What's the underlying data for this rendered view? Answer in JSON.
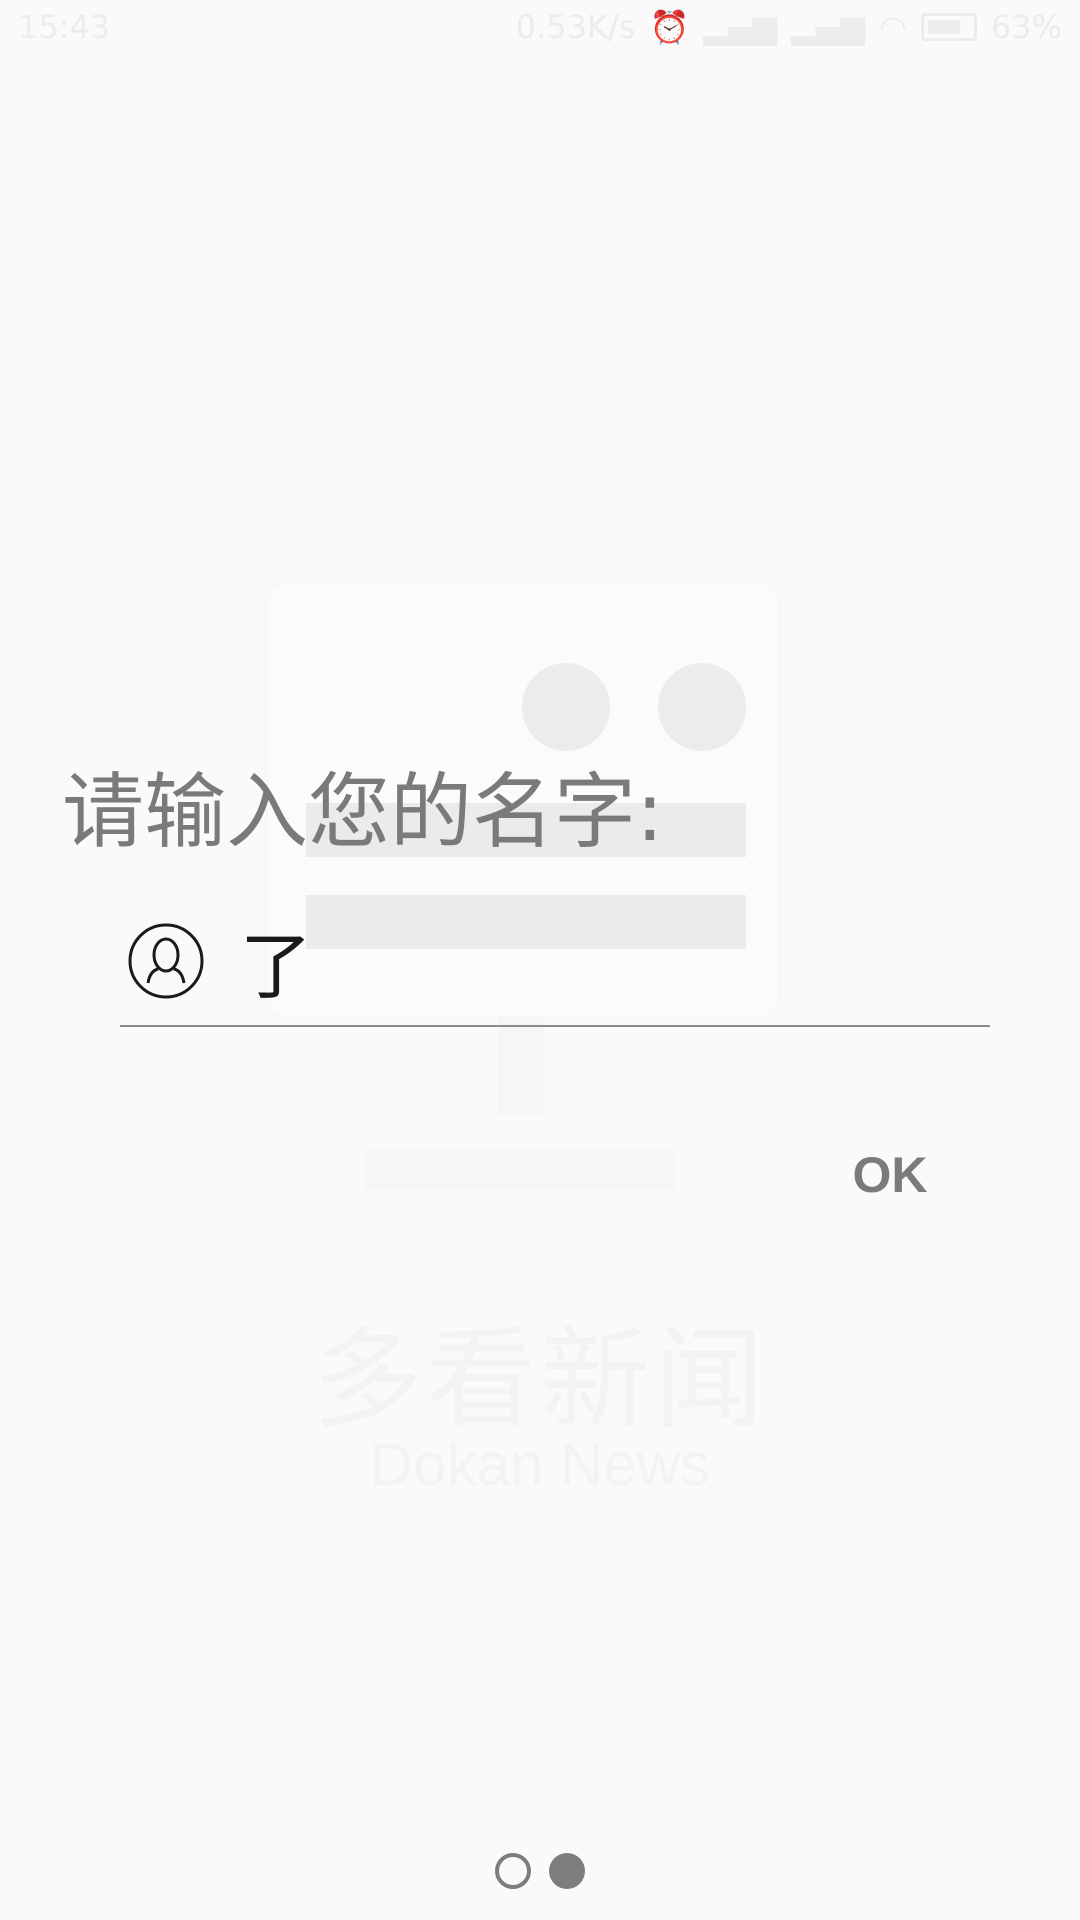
{
  "status_bar": {
    "time": "15:43",
    "network_speed": "0.53K/s",
    "battery": "63%",
    "icons": [
      "alarm-icon",
      "signal-icon",
      "signal-icon",
      "wifi-icon",
      "battery-icon"
    ]
  },
  "background": {
    "logo_cn": "多看新闻",
    "logo_en": "Dokan News"
  },
  "prompt": {
    "label": "请输入您的名字:"
  },
  "name_input": {
    "value": "了",
    "icon": "user-icon"
  },
  "actions": {
    "ok_label": "OK"
  },
  "pagination": {
    "total": 2,
    "current": 2
  },
  "colors": {
    "background": "#fafafa",
    "text_gray": "#7a7a7a",
    "input_text": "#1a1a1a",
    "underline": "#8a8a8a",
    "dot": "#7d7d7d"
  }
}
